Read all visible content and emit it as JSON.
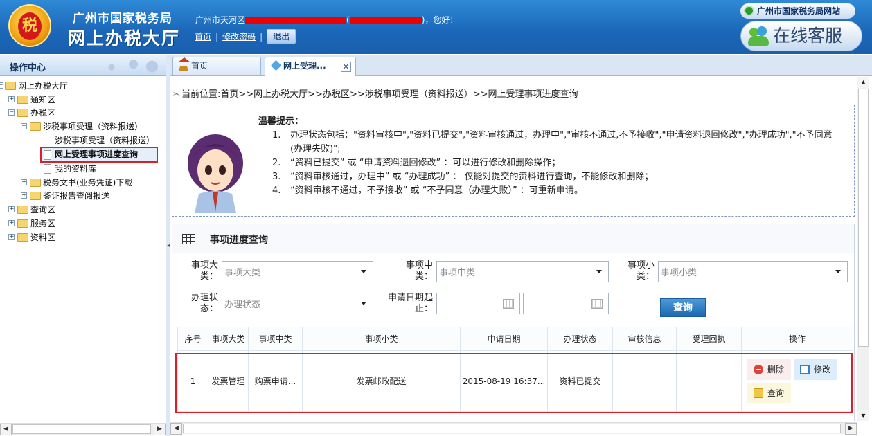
{
  "header": {
    "org_name": "广州市国家税务局",
    "system_name": "网上办税大厅",
    "welcome_prefix": "广州市天河区",
    "welcome_mid": "(",
    "welcome_suffix": ")，您好！",
    "link_home": "首页",
    "link_change_password": "修改密码",
    "logout_label": "退出",
    "site_link": "广州市国家税务局网站",
    "customer_service": "在线客服"
  },
  "sidebar": {
    "title": "操作中心",
    "nodes": [
      {
        "label": "网上办税大厅"
      },
      {
        "label": "通知区"
      },
      {
        "label": "办税区"
      },
      {
        "label": "涉税事项受理（资料报送）"
      },
      {
        "label": "涉税事项受理（资料报送）"
      },
      {
        "label": "网上受理事项进度查询"
      },
      {
        "label": "我的资料库"
      },
      {
        "label": "税务文书(业务凭证)下载"
      },
      {
        "label": "鉴证报告查阅报送"
      },
      {
        "label": "查询区"
      },
      {
        "label": "服务区"
      },
      {
        "label": "资料区"
      }
    ]
  },
  "tabs": {
    "home": "首页",
    "accept": "网上受理..."
  },
  "breadcrumb": "当前位置:首页>>网上办税大厅>>办税区>>涉税事项受理（资料报送）>>网上受理事项进度查询",
  "tips": {
    "title": "温馨提示：",
    "items": [
      {
        "num": "1.",
        "text": "办理状态包括：\"资料审核中\",\"资料已提交\",\"资料审核通过，办理中\",\"审核不通过,不予接收\",\"申请资料退回修改\",\"办理成功\",\"不予同意(办理失败)\";"
      },
      {
        "num": "2.",
        "text": "“资料已提交” 或 “申请资料退回修改” ：可以进行修改和删除操作；"
      },
      {
        "num": "3.",
        "text": "“资料审核通过，办理中” 或 “办理成功” ： 仅能对提交的资料进行查询，不能修改和删除；"
      },
      {
        "num": "4.",
        "text": "“资料审核不通过，不予接收” 或 “不予同意（办理失败）” ：可重新申请。"
      }
    ]
  },
  "query": {
    "title": "事项进度查询",
    "label_major": "事项大类：",
    "label_mid": "事项中类：",
    "label_minor": "事项小类：",
    "label_status": "办理状态：",
    "label_date": "申请日期起止：",
    "placeholder_major": "事项大类",
    "placeholder_mid": "事项中类",
    "placeholder_minor": "事项小类",
    "placeholder_status": "办理状态",
    "search_button": "查询"
  },
  "table": {
    "headers": [
      "序号",
      "事项大类",
      "事项中类",
      "事项小类",
      "申请日期",
      "办理状态",
      "审核信息",
      "受理回执",
      "操作"
    ],
    "rows": [
      {
        "seq": "1",
        "major": "发票管理",
        "mid": "购票申请...",
        "minor": "发票邮政配送",
        "date": "2015-08-19 16:37...",
        "status": "资料已提交",
        "review": "",
        "receipt": ""
      }
    ],
    "actions": {
      "delete": "删除",
      "edit": "修改",
      "query": "查询"
    }
  },
  "colors": {
    "header_blue": "#1b66b8",
    "highlight_red": "#d8202a",
    "search_button": "#1c68b0"
  }
}
